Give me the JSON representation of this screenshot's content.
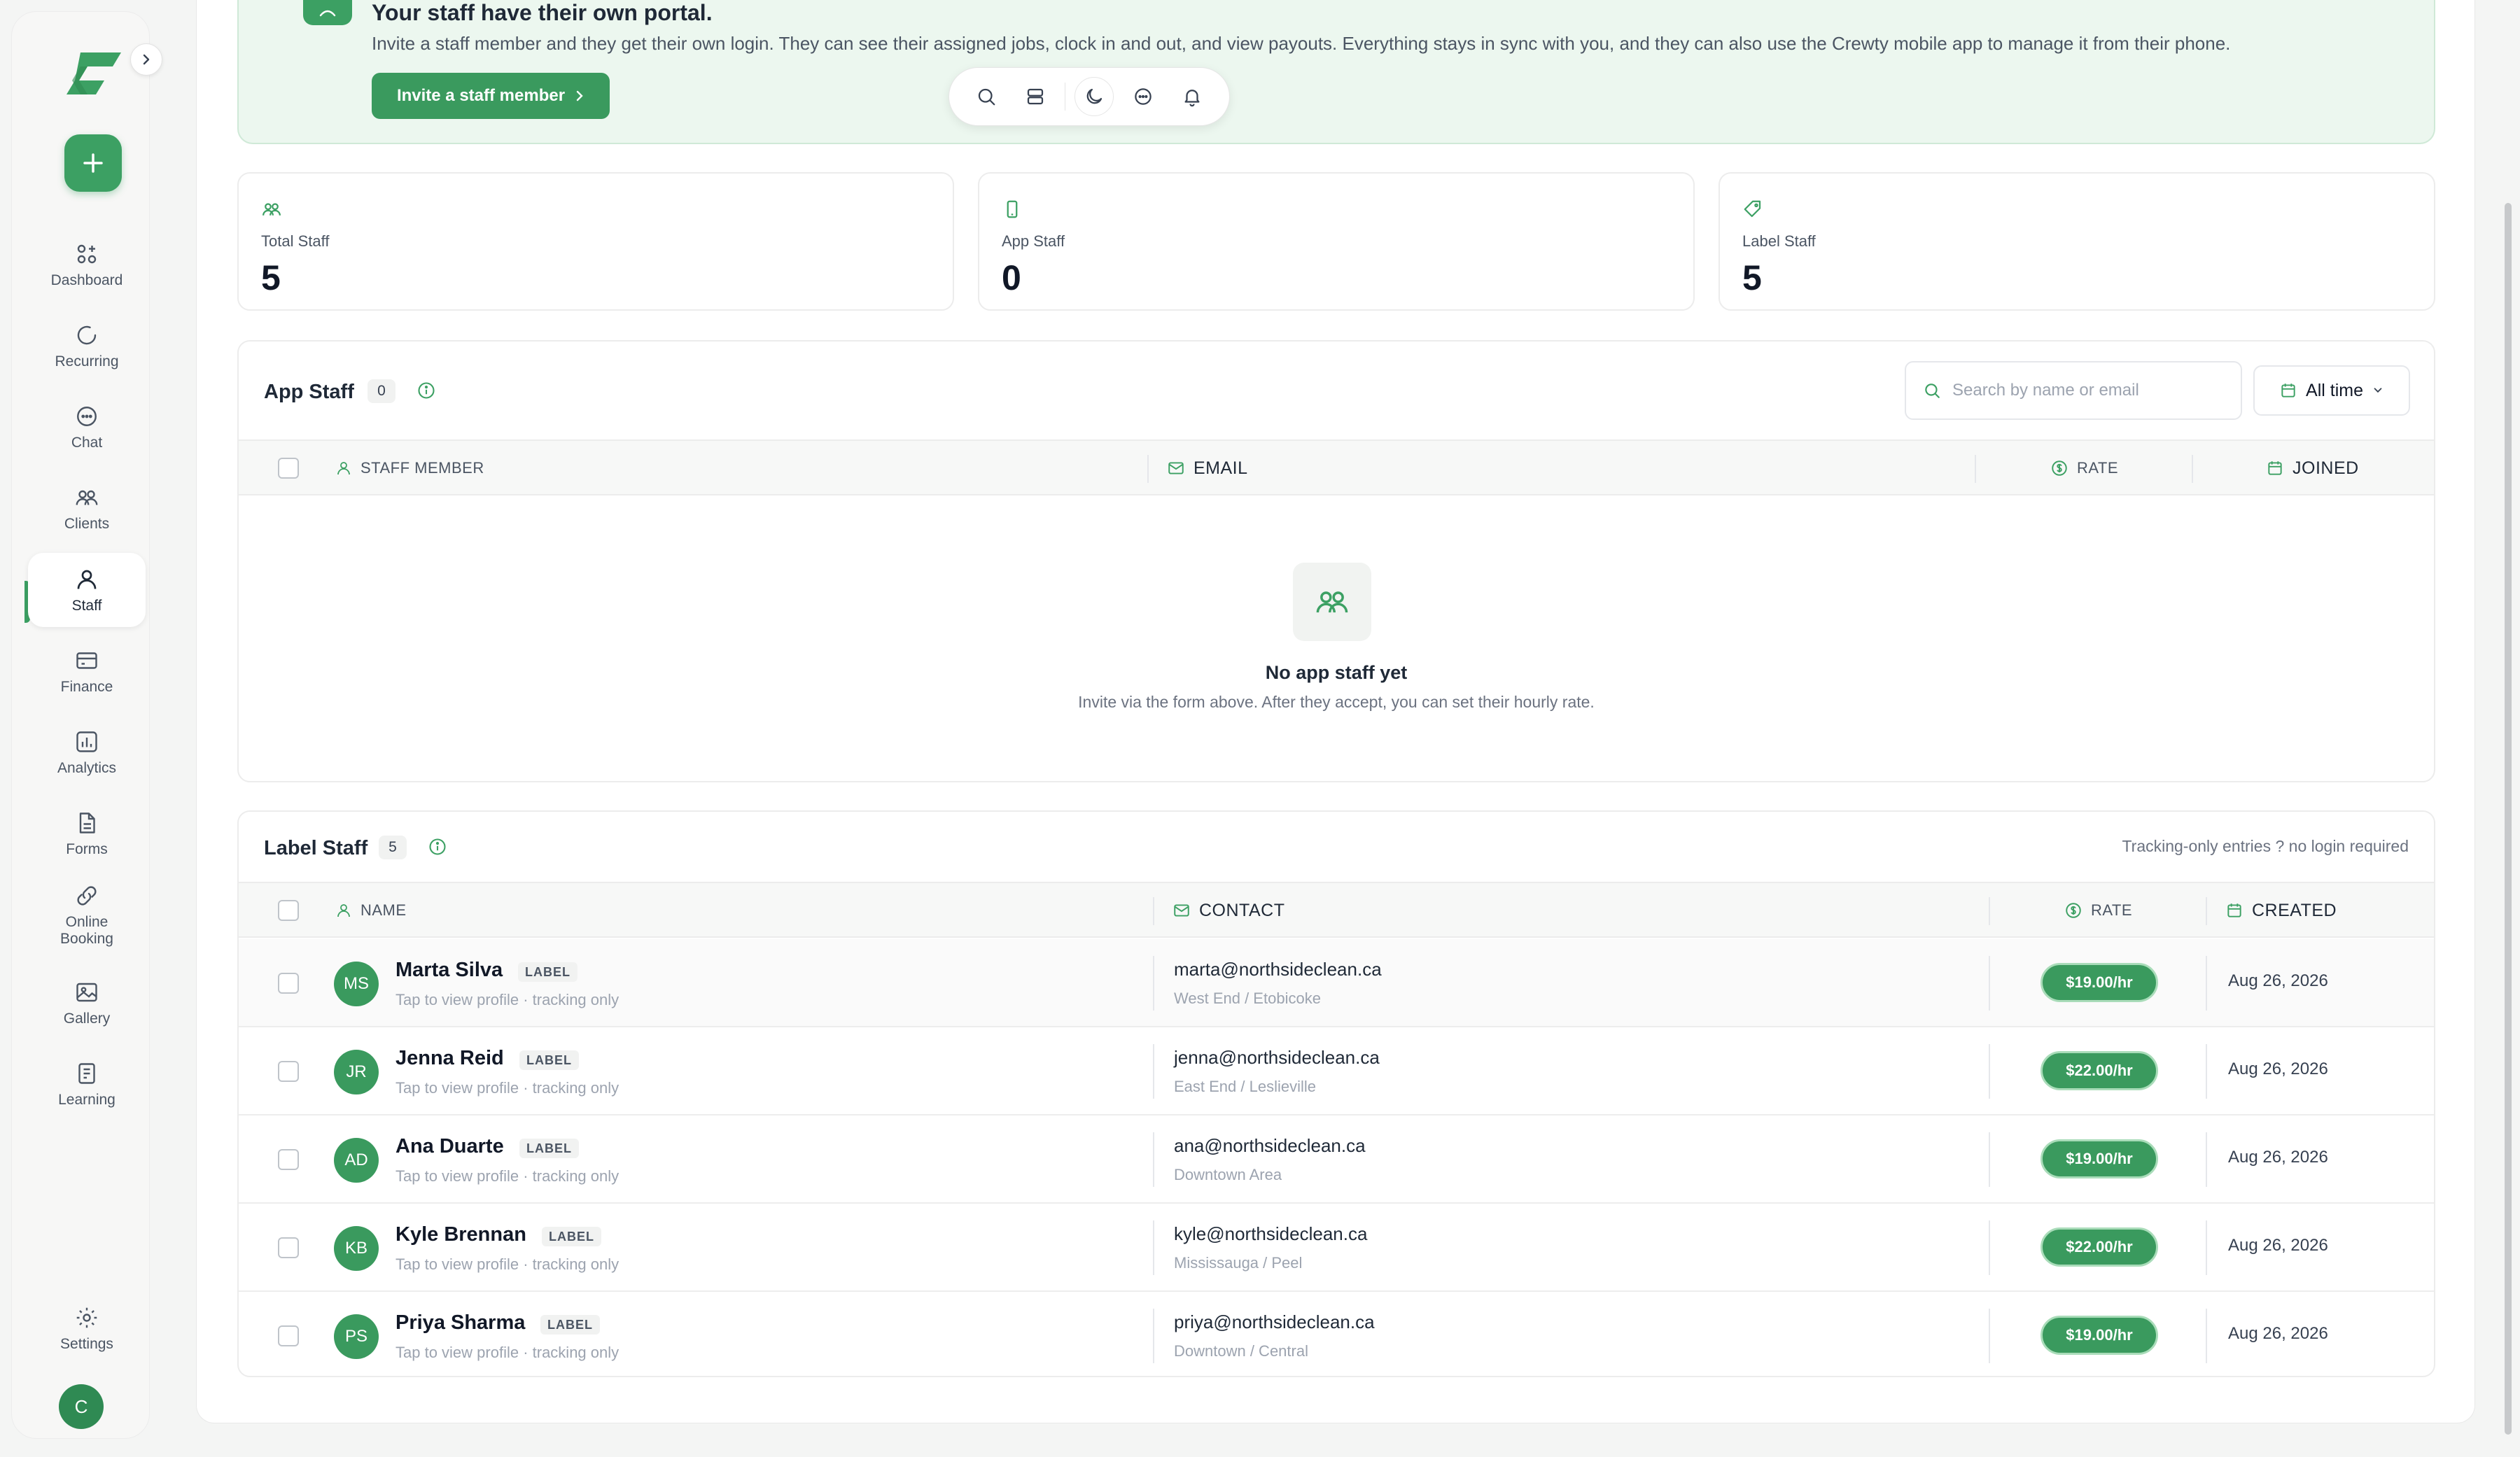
{
  "sidebar": {
    "items": [
      {
        "label": "Dashboard",
        "icon": "dashboard-icon"
      },
      {
        "label": "Recurring",
        "icon": "recurring-icon"
      },
      {
        "label": "Chat",
        "icon": "chat-icon"
      },
      {
        "label": "Clients",
        "icon": "clients-icon"
      },
      {
        "label": "Staff",
        "icon": "staff-icon"
      },
      {
        "label": "Finance",
        "icon": "finance-icon"
      },
      {
        "label": "Analytics",
        "icon": "analytics-icon"
      },
      {
        "label": "Forms",
        "icon": "forms-icon"
      },
      {
        "label": "Online Booking",
        "icon": "online-booking-icon"
      },
      {
        "label": "Gallery",
        "icon": "gallery-icon"
      },
      {
        "label": "Learning",
        "icon": "learning-icon"
      }
    ],
    "settings_label": "Settings",
    "avatar_initial": "C",
    "active_item": "Staff"
  },
  "banner": {
    "title": "Your staff have their own portal.",
    "description": "Invite a staff member and they get their own login. They can see their assigned jobs, clock in and out, and view payouts. Everything stays in sync with you, and they can also use the Crewty mobile app to manage it from their phone.",
    "invite_label": "Invite a staff member"
  },
  "stats": [
    {
      "label": "Total Staff",
      "value": "5",
      "icon": "users-icon"
    },
    {
      "label": "App Staff",
      "value": "0",
      "icon": "phone-icon"
    },
    {
      "label": "Label Staff",
      "value": "5",
      "icon": "tag-icon"
    }
  ],
  "app_staff": {
    "title": "App Staff",
    "count": "0",
    "search_placeholder": "Search by name or email",
    "time_filter": "All time",
    "columns": [
      "STAFF MEMBER",
      "EMAIL",
      "RATE",
      "JOINED"
    ],
    "empty_title": "No app staff yet",
    "empty_sub": "Invite via the form above. After they accept, you can set their hourly rate."
  },
  "label_staff": {
    "title": "Label Staff",
    "count": "5",
    "note": "Tracking-only entries ? no login required",
    "columns": [
      "NAME",
      "CONTACT",
      "RATE",
      "CREATED"
    ],
    "tag": "LABEL",
    "sub": "Tap to view profile · tracking only",
    "rows": [
      {
        "initials": "MS",
        "name": "Marta Silva",
        "email": "marta@northsideclean.ca",
        "area": "West End / Etobicoke",
        "rate": "$19.00/hr",
        "date": "Aug 26, 2026"
      },
      {
        "initials": "JR",
        "name": "Jenna Reid",
        "email": "jenna@northsideclean.ca",
        "area": "East End / Leslieville",
        "rate": "$22.00/hr",
        "date": "Aug 26, 2026"
      },
      {
        "initials": "AD",
        "name": "Ana Duarte",
        "email": "ana@northsideclean.ca",
        "area": "Downtown Area",
        "rate": "$19.00/hr",
        "date": "Aug 26, 2026"
      },
      {
        "initials": "KB",
        "name": "Kyle Brennan",
        "email": "kyle@northsideclean.ca",
        "area": "Mississauga / Peel",
        "rate": "$22.00/hr",
        "date": "Aug 26, 2026"
      },
      {
        "initials": "PS",
        "name": "Priya Sharma",
        "email": "priya@northsideclean.ca",
        "area": "Downtown / Central",
        "rate": "$19.00/hr",
        "date": "Aug 26, 2026"
      }
    ]
  },
  "colors": {
    "accent": "#3ca063",
    "accent_dark": "#2f8a53",
    "banner_bg": "#ecf7ef"
  }
}
